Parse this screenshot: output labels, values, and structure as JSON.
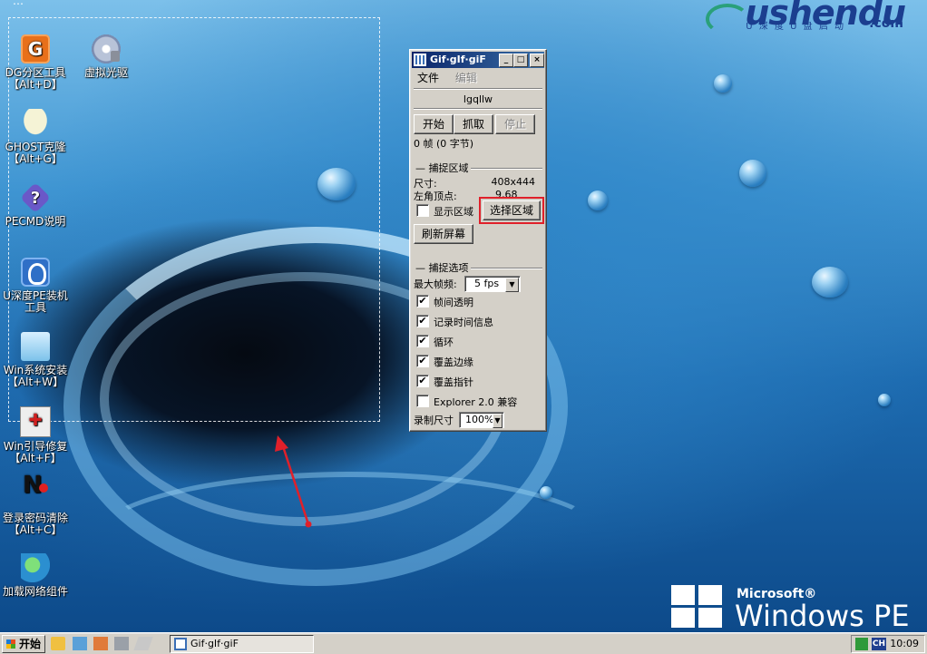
{
  "desktop": {
    "top_partial_text": "…",
    "logo": {
      "brand": "ushendu",
      "tagline": "U 深 度 U 盘 启 动",
      "domain": ".com"
    },
    "icons": [
      {
        "name": "dg-partition",
        "label_line1": "DG分区工具",
        "label_line2": "【Alt+D】",
        "icon": "dg-icon"
      },
      {
        "name": "virtual-cd",
        "label_line1": "虚拟光驱",
        "label_line2": "",
        "icon": "cd-icon"
      },
      {
        "name": "ghost",
        "label_line1": "GHOST克隆",
        "label_line2": "【Alt+G】",
        "icon": "ghost-icon"
      },
      {
        "name": "pecmd-help",
        "label_line1": "PECMD说明",
        "label_line2": "",
        "icon": "help-icon"
      },
      {
        "name": "pe-install",
        "label_line1": "U深度PE装机",
        "label_line2": "工具",
        "icon": "pe-tool-icon"
      },
      {
        "name": "win-setup",
        "label_line1": "Win系统安装",
        "label_line2": "【Alt+W】",
        "icon": "win-setup-icon"
      },
      {
        "name": "boot-repair",
        "label_line1": "Win引导修复",
        "label_line2": "【Alt+F】",
        "icon": "boot-repair-icon"
      },
      {
        "name": "password-clear",
        "label_line1": "登录密码清除",
        "label_line2": "【Alt+C】",
        "icon": "key-icon"
      },
      {
        "name": "network",
        "label_line1": "加载网络组件",
        "label_line2": "",
        "icon": "network-icon"
      }
    ],
    "winpe": {
      "brand": "Microsoft®",
      "product": "Windows PE"
    }
  },
  "window": {
    "title": "Gif·gIf·giF",
    "controls": {
      "minimize": "_",
      "maximize": "□",
      "close": "×"
    },
    "menu": {
      "file": "文件",
      "edit": "编辑"
    },
    "filename": "lgqllw",
    "buttons": {
      "start": "开始",
      "capture": "抓取",
      "stop": "停止"
    },
    "frame_info": "0 帧 (0 字节)",
    "capture_area": {
      "group_label": "捕捉区域",
      "size_label": "尺寸:",
      "size_value": "408x444",
      "corner_label": "左角顶点:",
      "corner_value": "9,68",
      "show_area_label": "显示区域",
      "show_area_checked": false,
      "select_area_button": "选择区域",
      "refresh_button": "刷新屏幕"
    },
    "capture_options": {
      "group_label": "捕捉选项",
      "max_fps_label": "最大帧频:",
      "max_fps_value": "5 fps",
      "options": [
        {
          "label": "帧间透明",
          "checked": true
        },
        {
          "label": "记录时间信息",
          "checked": true
        },
        {
          "label": "循环",
          "checked": true
        },
        {
          "label": "覆盖边缘",
          "checked": true
        },
        {
          "label": "覆盖指针",
          "checked": true
        },
        {
          "label": "Explorer 2.0 兼容",
          "checked": false
        }
      ],
      "record_size_label": "录制尺寸",
      "record_size_value": "100%"
    }
  },
  "taskbar": {
    "start_label": "开始",
    "task_button": "Gif·gIf·giF",
    "tray_lang": "CH",
    "clock": "10:09"
  },
  "colors": {
    "titlebar": "#0a246a",
    "highlight": "#e0202a",
    "annotation": "#e0202a"
  }
}
